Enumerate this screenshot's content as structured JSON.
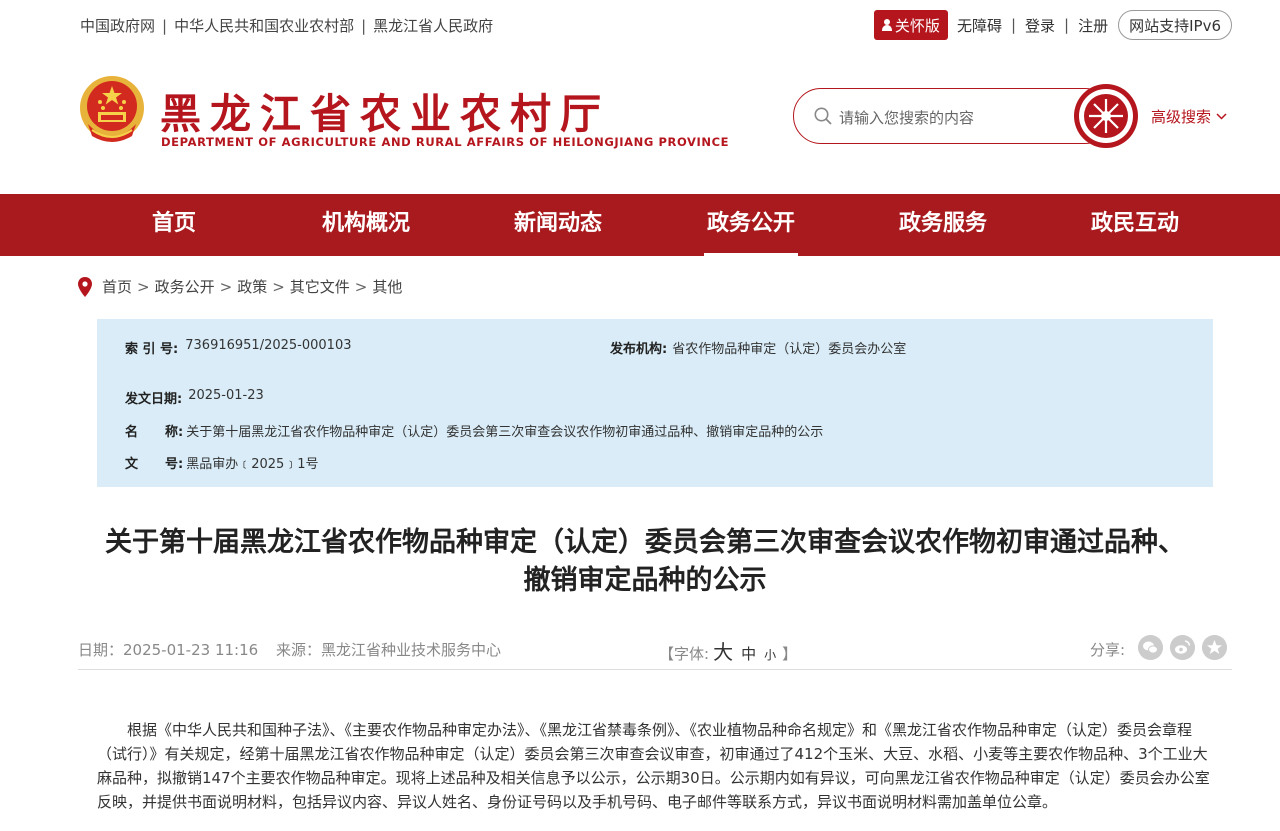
{
  "top": {
    "links": [
      "中国政府网",
      "中华人民共和国农业农村部",
      "黑龙江省人民政府"
    ],
    "care_label": "关怀版",
    "accessibility": "无障碍",
    "login": "登录",
    "register": "注册",
    "ipv6": "网站支持IPv6"
  },
  "header": {
    "title": "黑龙江省农业农村厅",
    "subtitle": "DEPARTMENT OF AGRICULTURE AND RURAL AFFAIRS OF HEILONGJIANG PROVINCE",
    "search_placeholder": "请输入您搜索的内容",
    "advanced_search": "高级搜索"
  },
  "nav": {
    "items": [
      "首页",
      "机构概况",
      "新闻动态",
      "政务公开",
      "政务服务",
      "政民互动"
    ],
    "active": "政务公开"
  },
  "breadcrumb": [
    "首页",
    "政务公开",
    "政策",
    "其它文件",
    "其他"
  ],
  "meta": {
    "index_label": "索 引 号:",
    "index_value": "736916951/2025-000103",
    "org_label": "发布机构:",
    "org_value": "省农作物品种审定（认定）委员会办公室",
    "date_label": "发文日期:",
    "date_value": "2025-01-23",
    "name_label_a": "名",
    "name_label_b": "称:",
    "name_value": "关于第十届黑龙江省农作物品种审定（认定）委员会第三次审查会议农作物初审通过品种、撤销审定品种的公示",
    "doc_label_a": "文",
    "doc_label_b": "号:",
    "doc_value": "黑品审办﹝2025﹞1号"
  },
  "article": {
    "title_line1": "关于第十届黑龙江省农作物品种审定（认定）委员会第三次审查会议农作物初审通过品种、",
    "title_line2": "撤销审定品种的公示",
    "date": "日期：2025-01-23 11:16",
    "source": "来源：黑龙江省种业技术服务中心",
    "font_label_open": "【字体:",
    "font_large": "大",
    "font_medium": "中",
    "font_small": "小",
    "font_label_close": "】",
    "share_label": "分享:",
    "body": "根据《中华人民共和国种子法》、《主要农作物品种审定办法》、《黑龙江省禁毒条例》、《农业植物品种命名规定》和《黑龙江省农作物品种审定（认定）委员会章程（试行）》有关规定，经第十届黑龙江省农作物品种审定（认定）委员会第三次审查会议审查，初审通过了412个玉米、大豆、水稻、小麦等主要农作物品种、3个工业大麻品种，拟撤销147个主要农作物品种审定。现将上述品种及相关信息予以公示，公示期30日。公示期内如有异议，可向黑龙江省农作物品种审定（认定）委员会办公室反映，并提供书面说明材料，包括异议内容、异议人姓名、身份证号码以及手机号码、电子邮件等联系方式，异议书面说明材料需加盖单位公章。"
  },
  "colors": {
    "brand": "#a91a1e",
    "meta_bg": "#d9ecf7"
  }
}
